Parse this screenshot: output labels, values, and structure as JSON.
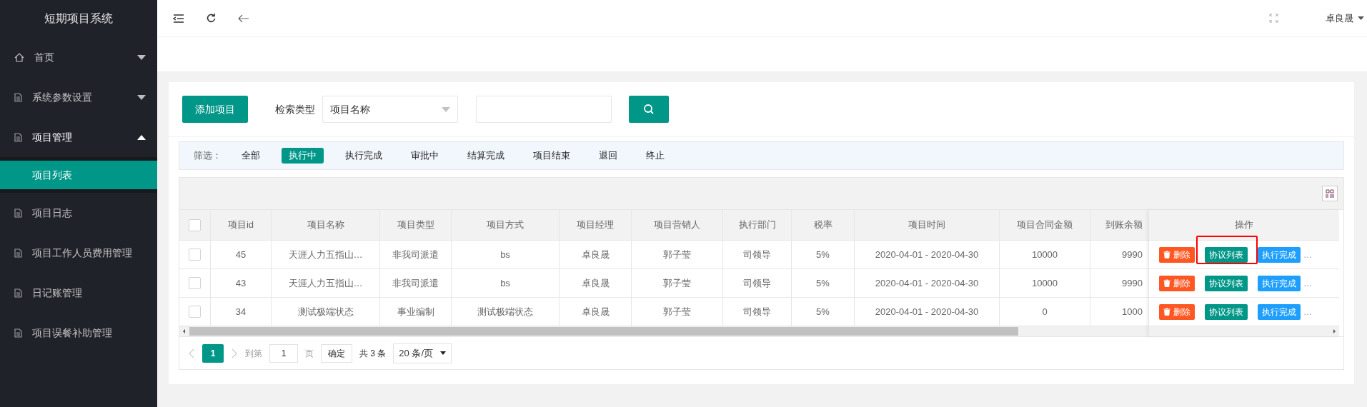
{
  "sidebar": {
    "title": "短期项目系统",
    "items": [
      {
        "label": "首页",
        "kind": "group",
        "expanded": false
      },
      {
        "label": "系统参数设置",
        "kind": "group",
        "expanded": false
      },
      {
        "label": "项目管理",
        "kind": "group",
        "expanded": true,
        "children": [
          {
            "label": "项目列表",
            "selected": true
          }
        ]
      },
      {
        "label": "项目日志",
        "kind": "link"
      },
      {
        "label": "项目工作人员费用管理",
        "kind": "link"
      },
      {
        "label": "日记账管理",
        "kind": "link"
      },
      {
        "label": "项目误餐补助管理",
        "kind": "link"
      }
    ]
  },
  "header": {
    "user": "卓良晟"
  },
  "toolbar": {
    "add_button": "添加项目",
    "search_type_label": "检索类型",
    "search_type": "项目名称"
  },
  "filter": {
    "label": "筛选：",
    "options": [
      {
        "label": "全部",
        "selected": false
      },
      {
        "label": "执行中",
        "selected": true
      },
      {
        "label": "执行完成",
        "selected": false
      },
      {
        "label": "审批中",
        "selected": false
      },
      {
        "label": "结算完成",
        "selected": false
      },
      {
        "label": "项目结束",
        "selected": false
      },
      {
        "label": "退回",
        "selected": false
      },
      {
        "label": "终止",
        "selected": false
      }
    ]
  },
  "table": {
    "select_all_checked": false,
    "columns": [
      "项目id",
      "项目名称",
      "项目类型",
      "项目方式",
      "项目经理",
      "项目营销人",
      "执行部门",
      "税率",
      "项目时间",
      "项目合同金额",
      "到账余额",
      "操作"
    ],
    "rows": [
      {
        "cells": [
          "45",
          "天涯人力五指山…",
          "非我司派遣",
          "bs",
          "卓良晟",
          "郭子莹",
          "司领导",
          "5%",
          "2020-04-01 - 2020-04-30",
          "10000",
          "9990"
        ],
        "actions": [
          "删除",
          "协议列表",
          "执行完成"
        ],
        "more": "…",
        "highlighted": true,
        "checked": false
      },
      {
        "cells": [
          "43",
          "天涯人力五指山…",
          "非我司派遣",
          "bs",
          "卓良晟",
          "郭子莹",
          "司领导",
          "5%",
          "2020-04-01 - 2020-04-30",
          "10000",
          "9990"
        ],
        "actions": [
          "删除",
          "协议列表",
          "执行完成"
        ],
        "more": "…",
        "highlighted": false,
        "checked": false
      },
      {
        "cells": [
          "34",
          "测试极端状态",
          "事业编制",
          "测试极端状态",
          "卓良晟",
          "郭子莹",
          "司领导",
          "5%",
          "2020-04-01 - 2020-04-30",
          "0",
          "1000"
        ],
        "actions": [
          "删除",
          "协议列表",
          "执行完成"
        ],
        "more": "…",
        "highlighted": false,
        "checked": false
      }
    ]
  },
  "pagination": {
    "current": "1",
    "goto_label": "到第",
    "goto_value": "1",
    "page_label": "页",
    "confirm": "确定",
    "total": "共 3 条",
    "per_page": "20 条/页"
  }
}
